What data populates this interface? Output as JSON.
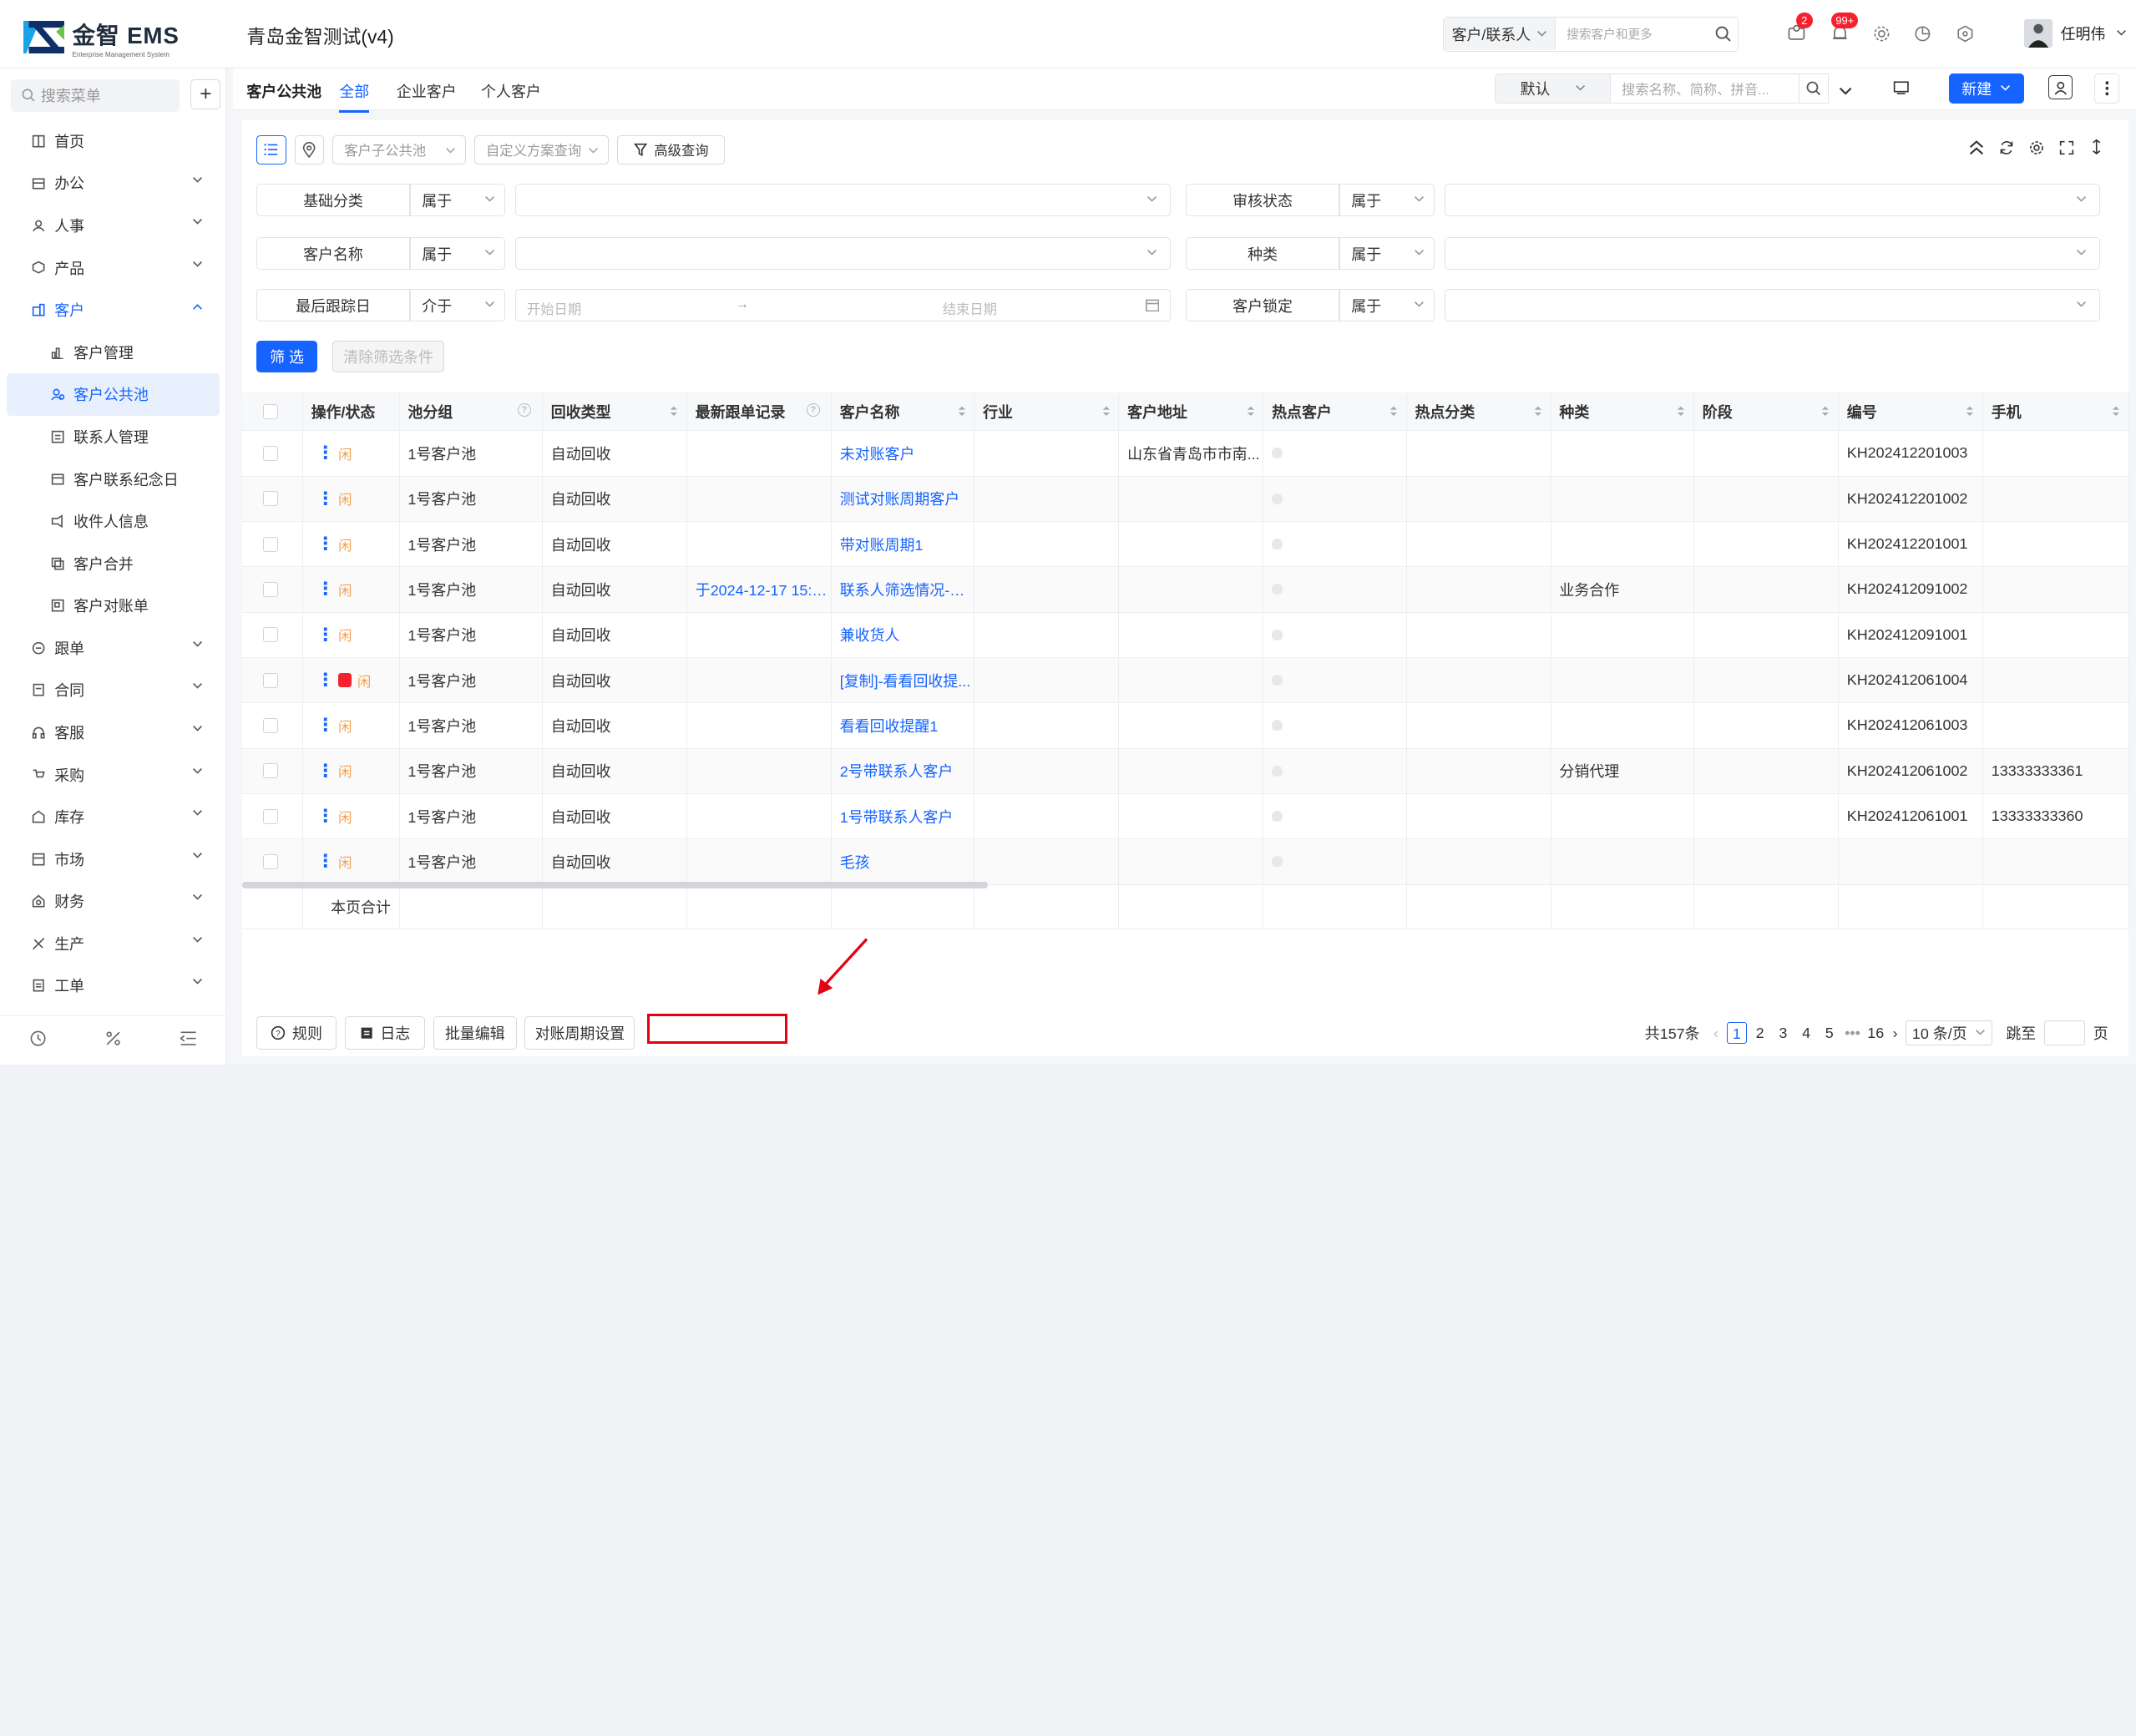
{
  "app": {
    "logo_title": "金智 EMS",
    "logo_sub": "Enterprise Management System",
    "title": "青岛金智测试(v4)"
  },
  "header": {
    "search_scope": "客户/联系人",
    "search_placeholder": "搜索客户和更多",
    "message_badge": "2",
    "notice_badge": "99+",
    "user_name": "任明伟"
  },
  "sidebar": {
    "search_placeholder": "搜索菜单",
    "items": [
      {
        "label": "首页",
        "icon": "home-icon",
        "has_chevron": false
      },
      {
        "label": "办公",
        "icon": "office-icon",
        "has_chevron": true
      },
      {
        "label": "人事",
        "icon": "people-icon",
        "has_chevron": true
      },
      {
        "label": "产品",
        "icon": "product-icon",
        "has_chevron": true
      },
      {
        "label": "客户",
        "icon": "customer-icon",
        "has_chevron": true,
        "open": true
      }
    ],
    "sub_items": [
      {
        "label": "客户管理",
        "icon": "chart-icon"
      },
      {
        "label": "客户公共池",
        "icon": "pool-icon",
        "active": true
      },
      {
        "label": "联系人管理",
        "icon": "contact-icon"
      },
      {
        "label": "客户联系纪念日",
        "icon": "calendar-icon"
      },
      {
        "label": "收件人信息",
        "icon": "mail-icon"
      },
      {
        "label": "客户合并",
        "icon": "merge-icon"
      },
      {
        "label": "客户对账单",
        "icon": "statement-icon"
      }
    ],
    "items_after": [
      {
        "label": "跟单",
        "icon": "follow-icon"
      },
      {
        "label": "合同",
        "icon": "contract-icon"
      },
      {
        "label": "客服",
        "icon": "service-icon"
      },
      {
        "label": "采购",
        "icon": "purchase-icon"
      },
      {
        "label": "库存",
        "icon": "stock-icon"
      },
      {
        "label": "市场",
        "icon": "market-icon"
      },
      {
        "label": "财务",
        "icon": "finance-icon"
      },
      {
        "label": "生产",
        "icon": "production-icon"
      },
      {
        "label": "工单",
        "icon": "workorder-icon"
      }
    ]
  },
  "tabs": {
    "section_title": "客户公共池",
    "items": [
      "全部",
      "企业客户",
      "个人客户"
    ],
    "view": "默认",
    "keyword_placeholder": "搜索名称、简称、拼音...",
    "new_label": "新建"
  },
  "toolbar": {
    "subpool_placeholder": "客户子公共池",
    "scheme_placeholder": "自定义方案查询",
    "advanced_label": "高级查询"
  },
  "filters": {
    "row1": {
      "left_label": "基础分类",
      "left_op": "属于",
      "right_label": "审核状态",
      "right_op": "属于"
    },
    "row2": {
      "left_label": "客户名称",
      "left_op": "属于",
      "right_label": "种类",
      "right_op": "属于"
    },
    "row3": {
      "left_label": "最后跟踪日",
      "left_op": "介于",
      "start_placeholder": "开始日期",
      "end_placeholder": "结束日期",
      "right_label": "客户锁定",
      "right_op": "属于"
    },
    "apply_label": "筛 选",
    "clear_label": "清除筛选条件"
  },
  "table": {
    "columns": [
      "操作/状态",
      "池分组",
      "回收类型",
      "最新跟单记录",
      "客户名称",
      "行业",
      "客户地址",
      "热点客户",
      "热点分类",
      "种类",
      "阶段",
      "编号",
      "手机"
    ],
    "rows": [
      {
        "group": "1号客户池",
        "recycle": "自动回收",
        "latest": "",
        "name": "未对账客户",
        "industry": "",
        "address": "山东省青岛市市南...",
        "category": "",
        "stage": "",
        "code": "KH202412201003",
        "phone": "",
        "locked": false
      },
      {
        "group": "1号客户池",
        "recycle": "自动回收",
        "latest": "",
        "name": "测试对账周期客户",
        "industry": "",
        "address": "",
        "category": "",
        "stage": "",
        "code": "KH202412201002",
        "phone": "",
        "locked": false
      },
      {
        "group": "1号客户池",
        "recycle": "自动回收",
        "latest": "",
        "name": "带对账周期1",
        "industry": "",
        "address": "",
        "category": "",
        "stage": "",
        "code": "KH202412201001",
        "phone": "",
        "locked": false
      },
      {
        "group": "1号客户池",
        "recycle": "自动回收",
        "latest": "于2024-12-17 15:36...",
        "name": "联系人筛选情况-带...",
        "industry": "",
        "address": "",
        "category": "业务合作",
        "stage": "",
        "code": "KH202412091002",
        "phone": "",
        "locked": false
      },
      {
        "group": "1号客户池",
        "recycle": "自动回收",
        "latest": "",
        "name": "兼收货人",
        "industry": "",
        "address": "",
        "category": "",
        "stage": "",
        "code": "KH202412091001",
        "phone": "",
        "locked": false
      },
      {
        "group": "1号客户池",
        "recycle": "自动回收",
        "latest": "",
        "name": "[复制]-看看回收提...",
        "industry": "",
        "address": "",
        "category": "",
        "stage": "",
        "code": "KH202412061004",
        "phone": "",
        "locked": true
      },
      {
        "group": "1号客户池",
        "recycle": "自动回收",
        "latest": "",
        "name": "看看回收提醒1",
        "industry": "",
        "address": "",
        "category": "",
        "stage": "",
        "code": "KH202412061003",
        "phone": "",
        "locked": false
      },
      {
        "group": "1号客户池",
        "recycle": "自动回收",
        "latest": "",
        "name": "2号带联系人客户",
        "industry": "",
        "address": "",
        "category": "分销代理",
        "stage": "",
        "code": "KH202412061002",
        "phone": "13333333361",
        "locked": false
      },
      {
        "group": "1号客户池",
        "recycle": "自动回收",
        "latest": "",
        "name": "1号带联系人客户",
        "industry": "",
        "address": "",
        "category": "",
        "stage": "",
        "code": "KH202412061001",
        "phone": "13333333360",
        "locked": false
      },
      {
        "group": "1号客户池",
        "recycle": "自动回收",
        "latest": "",
        "name": "毛孩",
        "industry": "",
        "address": "",
        "category": "",
        "stage": "",
        "code": "",
        "phone": "",
        "locked": false
      }
    ],
    "row_tag": "闲",
    "total_label": "本页合计"
  },
  "footer": {
    "buttons": [
      "规则",
      "日志",
      "批量编辑",
      "对账周期设置"
    ],
    "total": "共157条",
    "pages": [
      "1",
      "2",
      "3",
      "4",
      "5",
      "•••",
      "16"
    ],
    "page_size": "10 条/页",
    "jump_label": "跳至",
    "page_unit": "页"
  },
  "colors": {
    "accent": "#1664ff",
    "annotation": "#e60012"
  }
}
